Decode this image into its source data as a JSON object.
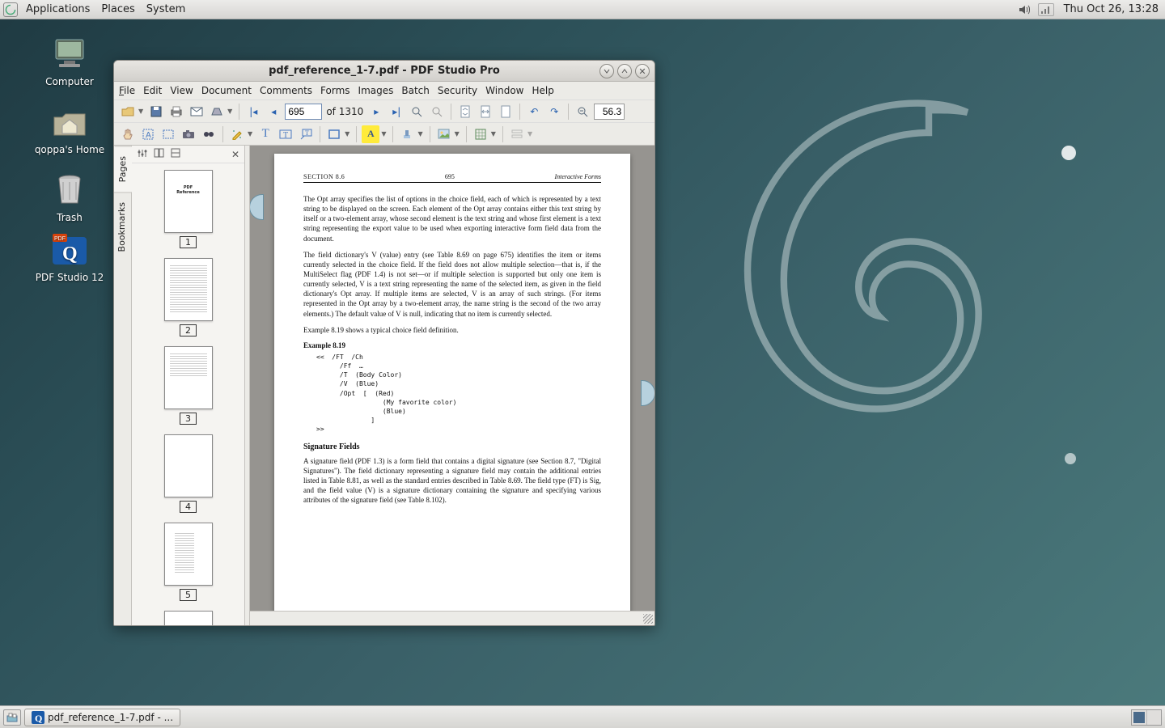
{
  "panel": {
    "menus": [
      "Applications",
      "Places",
      "System"
    ],
    "clock": "Thu Oct 26, 13:28"
  },
  "desktop_icons": [
    {
      "label": "Computer",
      "kind": "computer"
    },
    {
      "label": "qoppa's Home",
      "kind": "home"
    },
    {
      "label": "Trash",
      "kind": "trash"
    },
    {
      "label": "PDF Studio 12",
      "kind": "pdfstudio"
    }
  ],
  "taskbar": {
    "task_label": "pdf_reference_1-7.pdf - ..."
  },
  "window": {
    "title": "pdf_reference_1-7.pdf - PDF Studio Pro",
    "menubar": [
      "File",
      "Edit",
      "View",
      "Document",
      "Comments",
      "Forms",
      "Images",
      "Batch",
      "Security",
      "Window",
      "Help"
    ],
    "toolbar1": {
      "page_value": "695",
      "page_total": "of 1310",
      "zoom_value": "56.3"
    },
    "side_tabs": [
      "Pages",
      "Bookmarks"
    ],
    "thumbs": [
      "1",
      "2",
      "3",
      "4",
      "5"
    ],
    "page": {
      "header_left": "SECTION 8.6",
      "header_center": "695",
      "header_right": "Interactive Forms",
      "para1": "The Opt array specifies the list of options in the choice field, each of which is represented by a text string to be displayed on the screen. Each element of the Opt array contains either this text string by itself or a two-element array, whose second element is the text string and whose first element is a text string representing the export value to be used when exporting interactive form field data from the document.",
      "para2": "The field dictionary's V (value) entry (see Table 8.69 on page 675) identifies the item or items currently selected in the choice field. If the field does not allow multiple selection—that is, if the MultiSelect flag (PDF 1.4) is not set—or if multiple selection is supported but only one item is currently selected, V is a text string representing the name of the selected item, as given in the field dictionary's Opt array. If multiple items are selected, V is an array of such strings. (For items represented in the Opt array by a two-element array, the name string is the second of the two array elements.) The default value of V is null, indicating that no item is currently selected.",
      "para3": "Example 8.19 shows a typical choice field definition.",
      "example_title": "Example 8.19",
      "code": "<<  /FT  /Ch\n      /Ff  …\n      /T  (Body Color)\n      /V  (Blue)\n      /Opt  [  (Red)\n                 (My favorite color)\n                 (Blue)\n              ]\n>>",
      "subhead": "Signature Fields",
      "para4": "A signature field (PDF 1.3) is a form field that contains a digital signature (see Section 8.7, \"Digital Signatures\"). The field dictionary representing a signature field may contain the additional entries listed in Table 8.81, as well as the standard entries described in Table 8.69. The field type (FT) is Sig, and the field value (V) is a signature dictionary containing the signature and specifying various attributes of the signature field (see Table 8.102)."
    }
  }
}
